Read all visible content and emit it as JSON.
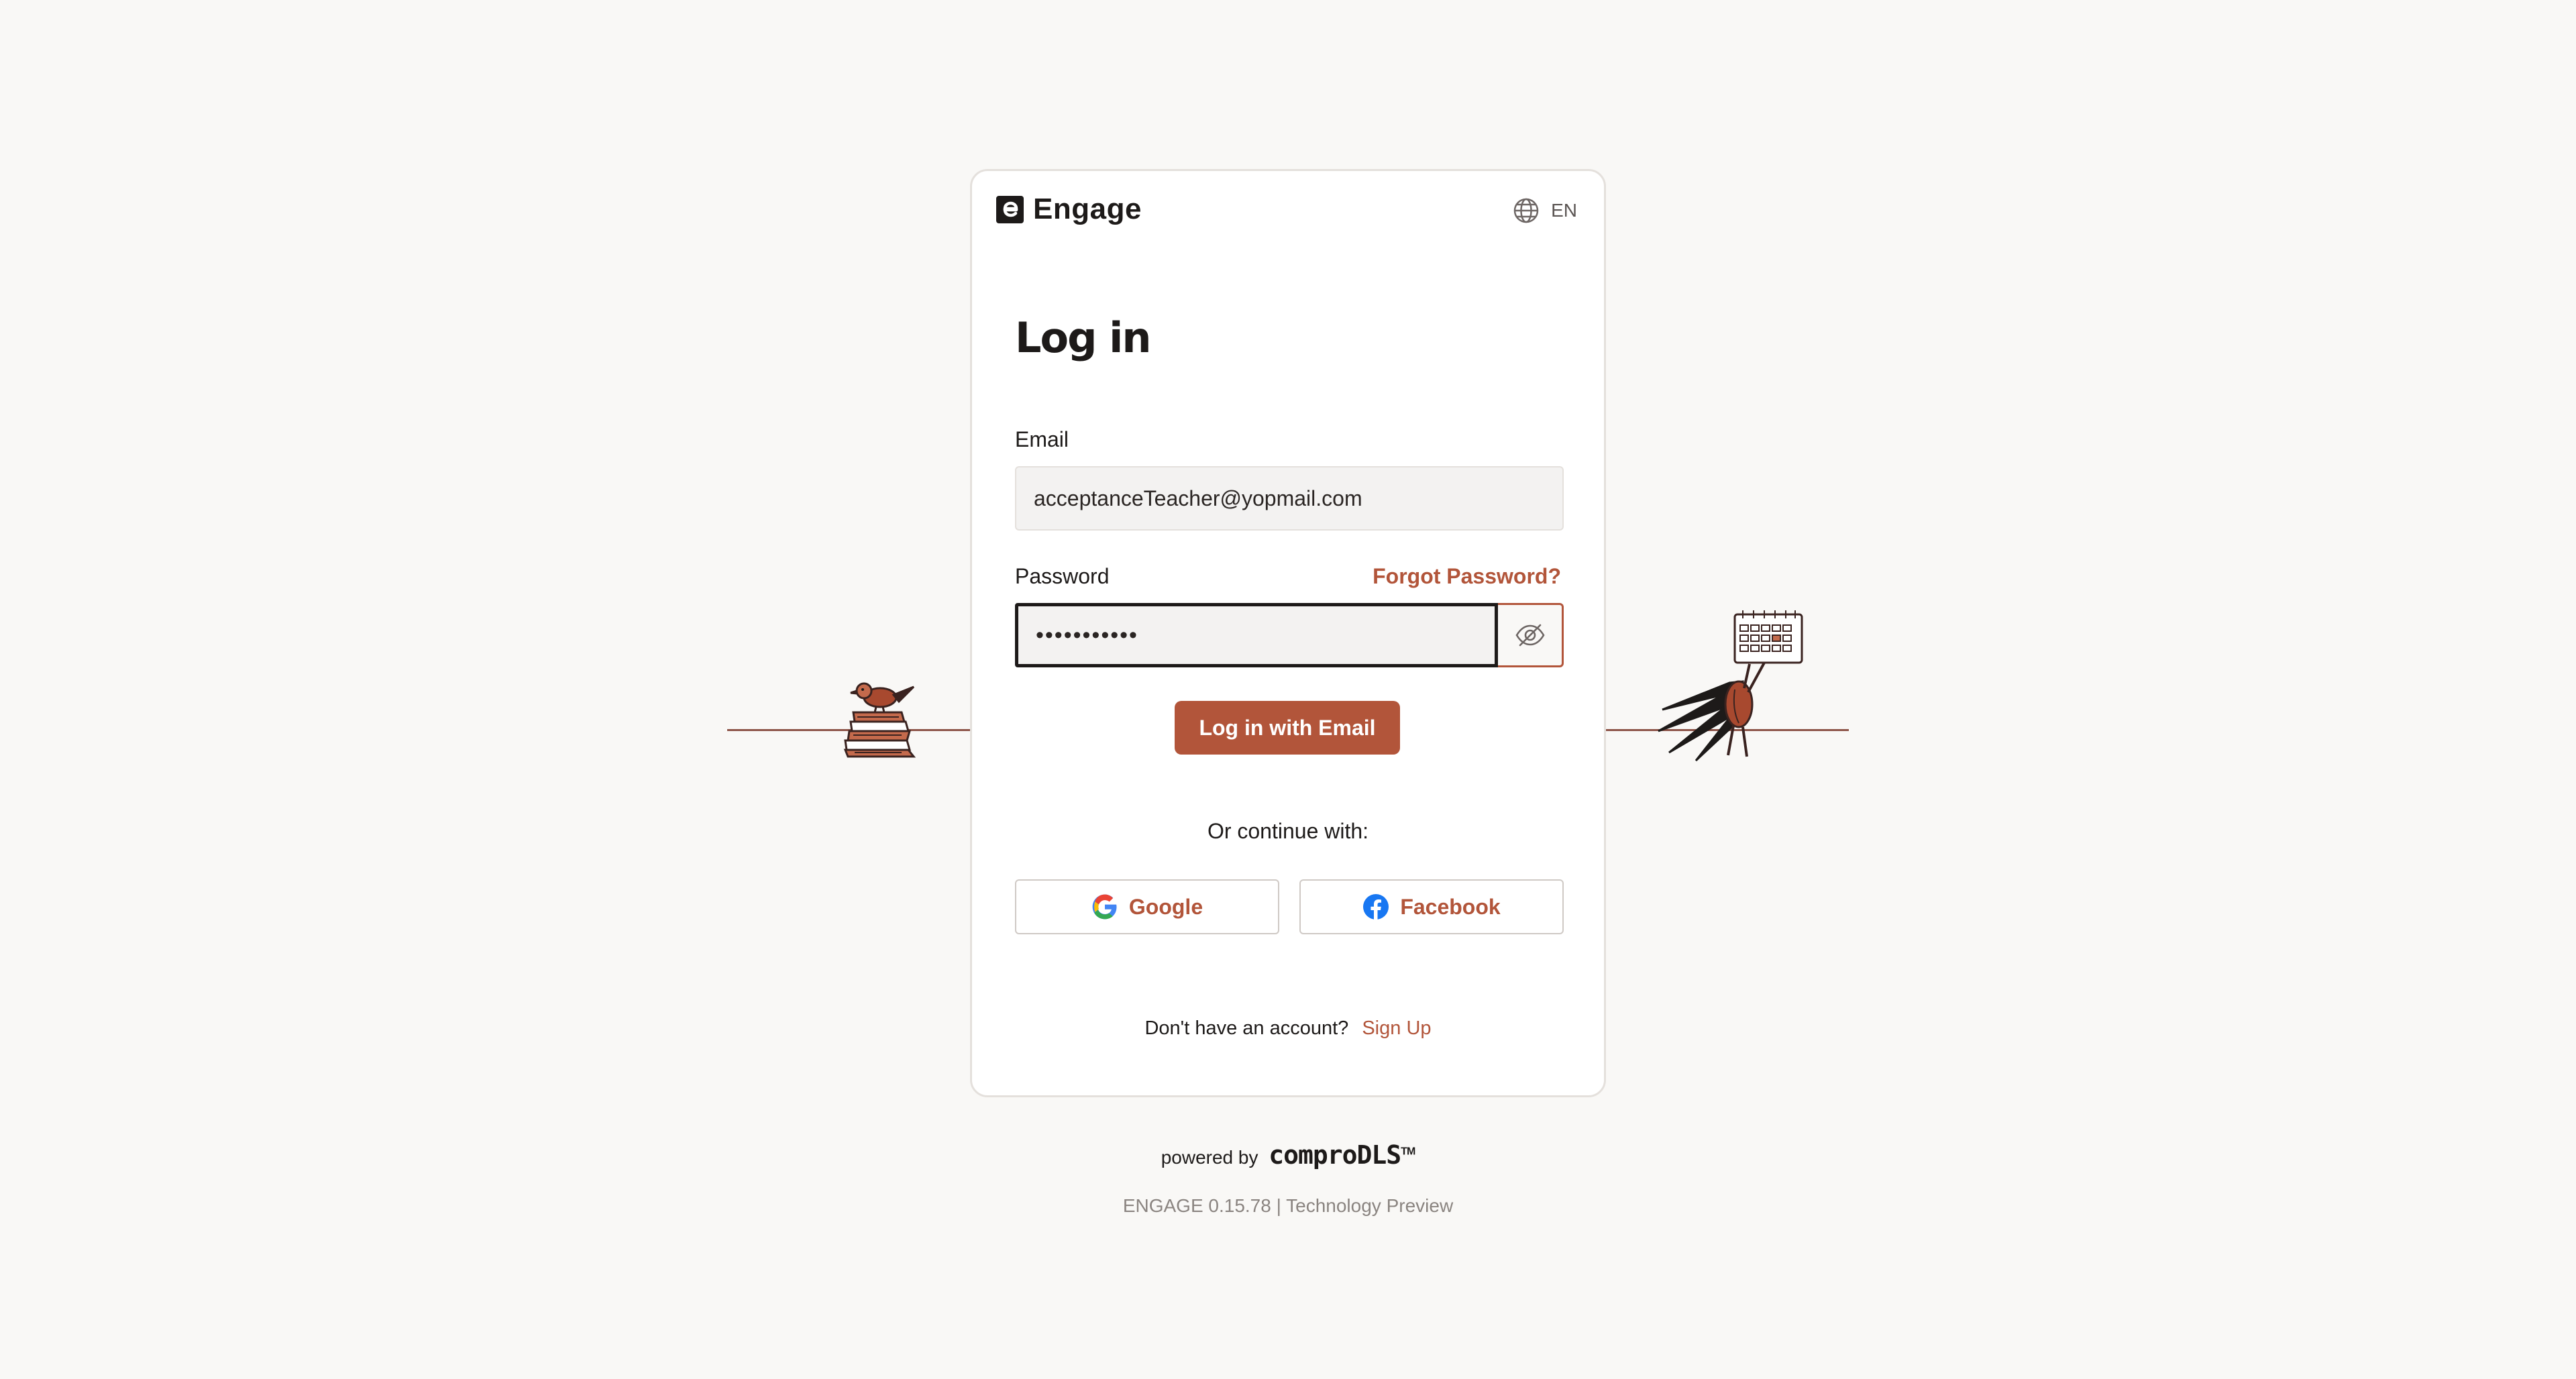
{
  "brand": {
    "name": "Engage",
    "logo_letter": "e"
  },
  "language": {
    "icon": "globe-icon",
    "code": "EN"
  },
  "login": {
    "title": "Log in",
    "email_label": "Email",
    "email_value": "acceptanceTeacher@yopmail.com",
    "password_label": "Password",
    "password_value": "•••••••••••",
    "forgot_label": "Forgot Password?",
    "toggle_icon": "eye-off-icon",
    "submit_label": "Log in with Email"
  },
  "social": {
    "prompt": "Or continue with:",
    "google_label": "Google",
    "facebook_label": "Facebook"
  },
  "signup": {
    "prompt": "Don't have an account?",
    "link": "Sign Up"
  },
  "footer": {
    "powered_prefix": "powered by",
    "powered_brand": "comproDLS",
    "powered_tm": "TM",
    "version": "ENGAGE 0.15.78 | Technology Preview"
  },
  "colors": {
    "accent": "#b2553a",
    "background": "#f9f8f6",
    "text": "#1d1a19"
  }
}
